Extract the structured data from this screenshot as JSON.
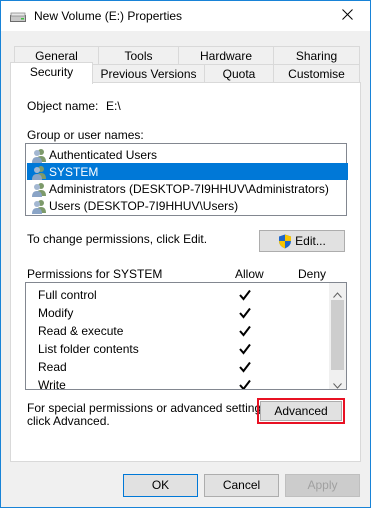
{
  "window": {
    "title": "New Volume (E:) Properties"
  },
  "tabs": {
    "row1": [
      "General",
      "Tools",
      "Hardware",
      "Sharing"
    ],
    "row2": [
      "Security",
      "Previous Versions",
      "Quota",
      "Customise"
    ],
    "active": "Security"
  },
  "security": {
    "object_label": "Object name:",
    "object_value": "E:\\",
    "group_label": "Group or user names:",
    "users": [
      "Authenticated Users",
      "SYSTEM",
      "Administrators (DESKTOP-7I9HHUV\\Administrators)",
      "Users (DESKTOP-7I9HHUV\\Users)"
    ],
    "selected_user": "SYSTEM",
    "change_hint": "To change permissions, click Edit.",
    "edit_button": "Edit...",
    "perm_label": "Permissions for SYSTEM",
    "allow_header": "Allow",
    "deny_header": "Deny",
    "permissions": [
      "Full control",
      "Modify",
      "Read & execute",
      "List folder contents",
      "Read",
      "Write"
    ],
    "special_hint_line1": "For special permissions or advanced settings,",
    "special_hint_line2": "click Advanced.",
    "advanced_button": "Advanced"
  },
  "footer": {
    "ok": "OK",
    "cancel": "Cancel",
    "apply": "Apply"
  },
  "colors": {
    "selection": "#0078d7",
    "highlight_border": "#e81123"
  },
  "icons": {
    "title": "drive-icon",
    "close": "close-icon",
    "user": "users-icon",
    "shield": "shield-icon",
    "check": "checkmark-icon"
  }
}
